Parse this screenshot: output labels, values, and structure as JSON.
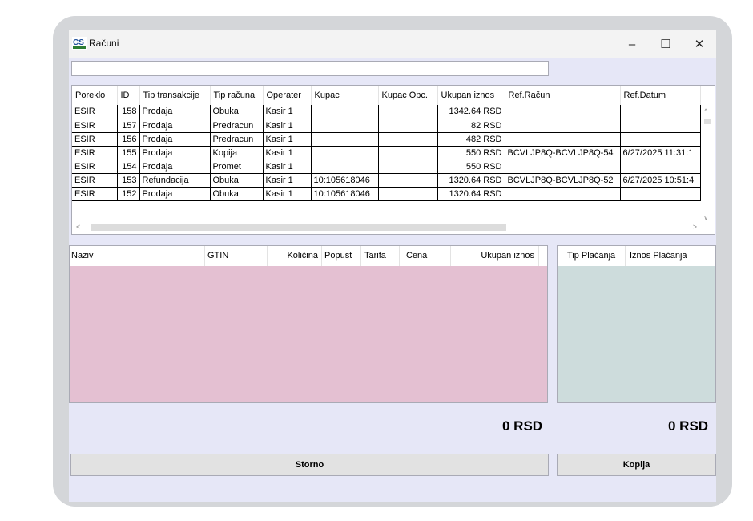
{
  "window": {
    "title": "Računi",
    "app_icon": "cs-logo-icon",
    "controls": {
      "minimize": "–",
      "maximize": "☐",
      "close": "✕"
    }
  },
  "search": {
    "value": "",
    "placeholder": ""
  },
  "receipts": {
    "columns": [
      "Poreklo",
      "ID",
      "Tip transakcije",
      "Tip računa",
      "Operater",
      "Kupac",
      "Kupac Opc.",
      "Ukupan iznos",
      "Ref.Račun",
      "Ref.Datum"
    ],
    "rows": [
      [
        "ESIR",
        "158",
        "Prodaja",
        "Obuka",
        "Kasir 1",
        "",
        "",
        "1342.64 RSD",
        "",
        ""
      ],
      [
        "ESIR",
        "157",
        "Prodaja",
        "Predracun",
        "Kasir 1",
        "",
        "",
        "82 RSD",
        "",
        ""
      ],
      [
        "ESIR",
        "156",
        "Prodaja",
        "Predracun",
        "Kasir 1",
        "",
        "",
        "482 RSD",
        "",
        ""
      ],
      [
        "ESIR",
        "155",
        "Prodaja",
        "Kopija",
        "Kasir 1",
        "",
        "",
        "550 RSD",
        "BCVLJP8Q-BCVLJP8Q-54",
        "6/27/2025 11:31:1"
      ],
      [
        "ESIR",
        "154",
        "Prodaja",
        "Promet",
        "Kasir 1",
        "",
        "",
        "550 RSD",
        "",
        ""
      ],
      [
        "ESIR",
        "153",
        "Refundacija",
        "Obuka",
        "Kasir 1",
        "10:105618046",
        "",
        "1320.64 RSD",
        "BCVLJP8Q-BCVLJP8Q-52",
        "6/27/2025 10:51:4"
      ],
      [
        "ESIR",
        "152",
        "Prodaja",
        "Obuka",
        "Kasir 1",
        "10:105618046",
        "",
        "1320.64 RSD",
        "",
        ""
      ]
    ]
  },
  "items": {
    "columns": [
      "Naziv",
      "GTIN",
      "Količina",
      "Popust",
      "Tarifa",
      "Cena",
      "Ukupan iznos"
    ],
    "total": "0 RSD"
  },
  "payments": {
    "columns": [
      "Tip Plaćanja",
      "Iznos Plaćanja"
    ],
    "total": "0 RSD"
  },
  "buttons": {
    "storno": "Storno",
    "kopija": "Kopija"
  },
  "colors": {
    "client_bg": "#e6e7f7",
    "items_bg": "#e4c0d2",
    "payments_bg": "#cddcdc"
  }
}
